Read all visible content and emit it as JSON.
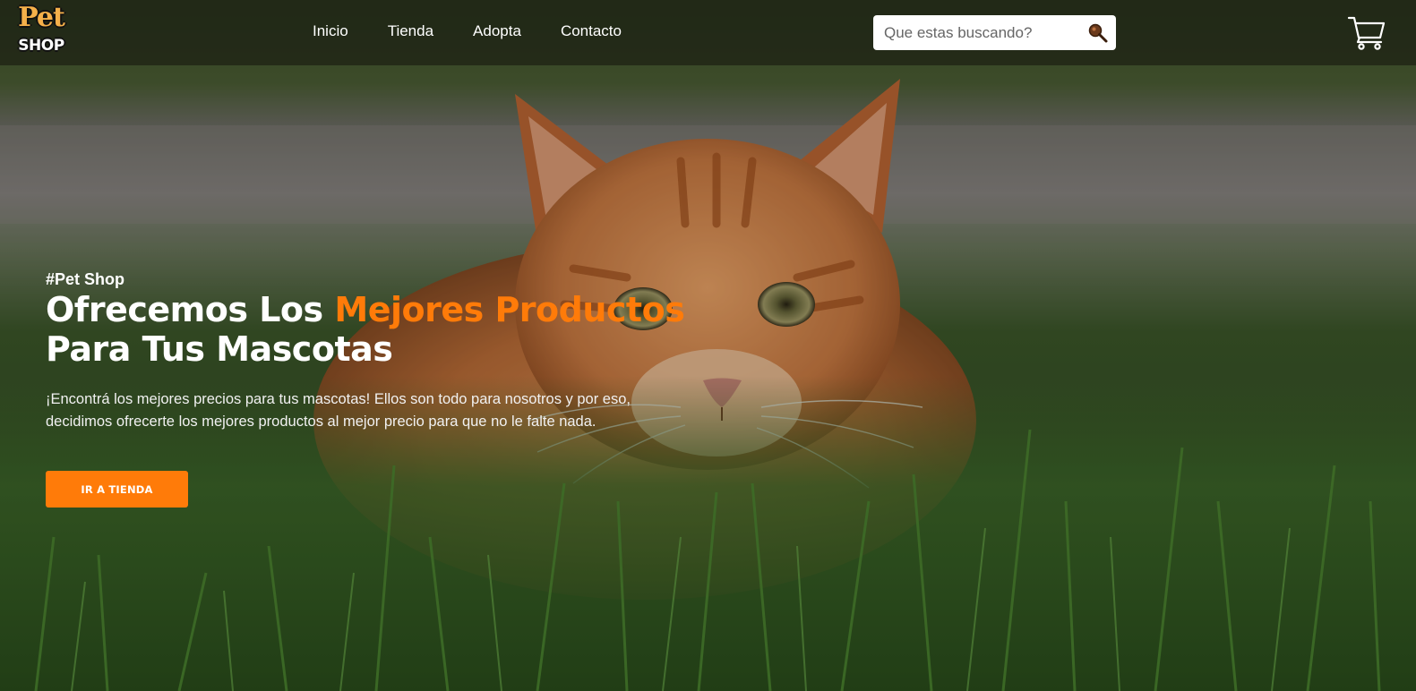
{
  "brand": {
    "logo_top": "Pet",
    "logo_bottom": "SHOP",
    "accent_color": "#ff7b09"
  },
  "nav": {
    "items": [
      "Inicio",
      "Tienda",
      "Adopta",
      "Contacto"
    ]
  },
  "search": {
    "placeholder": "Que estas buscando?",
    "value": "",
    "icon": "search-icon"
  },
  "cart": {
    "icon": "cart-icon"
  },
  "hero": {
    "tag": "#Pet Shop",
    "headline_part1": "Ofrecemos Los ",
    "headline_highlight": "Mejores Productos",
    "headline_line2": "Para Tus Mascotas",
    "description_line1": "¡Encontrá los mejores precios para tus mascotas! Ellos son todo para nosotros y por eso,",
    "description_line2": "decidimos ofrecerte los mejores productos al mejor precio para que no le falte nada.",
    "cta_label": "IR A TIENDA"
  }
}
